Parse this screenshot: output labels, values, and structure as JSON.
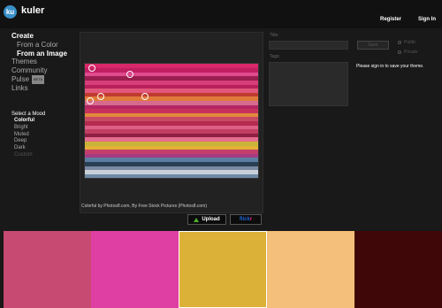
{
  "header": {
    "logo": "ku",
    "brand": "kuler",
    "register": "Register",
    "signin": "Sign In"
  },
  "nav": {
    "create": "Create",
    "from_color": "From a Color",
    "from_image": "From an Image",
    "themes": "Themes",
    "community": "Community",
    "pulse": "Pulse",
    "beta": "BETA",
    "links": "Links"
  },
  "mood": {
    "heading": "Select a Mood",
    "options": [
      "Colorful",
      "Bright",
      "Muted",
      "Deep",
      "Dark",
      "Custom"
    ],
    "selected": "Colorful"
  },
  "image": {
    "credit": "Colorful by Photos8.com, By Free Stock Pictures (Photos8.com)",
    "stripe_colors": [
      "#d8286a",
      "#c21e62",
      "#e04b8e",
      "#9a1e4f",
      "#d63d79",
      "#b81f5c",
      "#e2577b",
      "#c03b2f",
      "#e07a3a",
      "#d66a8e",
      "#b32763",
      "#c7325d",
      "#e18a3c",
      "#c84a63",
      "#b42a50",
      "#de5f85",
      "#c13f61",
      "#8e1e44",
      "#e56d8d",
      "#c8b43a",
      "#e2b238",
      "#c53f6c",
      "#a63b82",
      "#5c7fa1",
      "#2a3f53",
      "#7a8aa3",
      "#c9d0d8",
      "#6e8aa6"
    ]
  },
  "actions": {
    "upload": "Upload",
    "flickr_a": "flick",
    "flickr_b": "r"
  },
  "form": {
    "title_label": "Title:",
    "tags_label": "Tags:",
    "save": "Save",
    "public": "Public",
    "private": "Private",
    "signin_msg": "Please sign in to save your theme."
  },
  "swatches": [
    {
      "color": "#c64a71",
      "selected": false
    },
    {
      "color": "#df3fa3",
      "selected": false
    },
    {
      "color": "#dcb138",
      "selected": true
    },
    {
      "color": "#f3bf7a",
      "selected": false
    },
    {
      "color": "#3f0707",
      "selected": false
    }
  ]
}
